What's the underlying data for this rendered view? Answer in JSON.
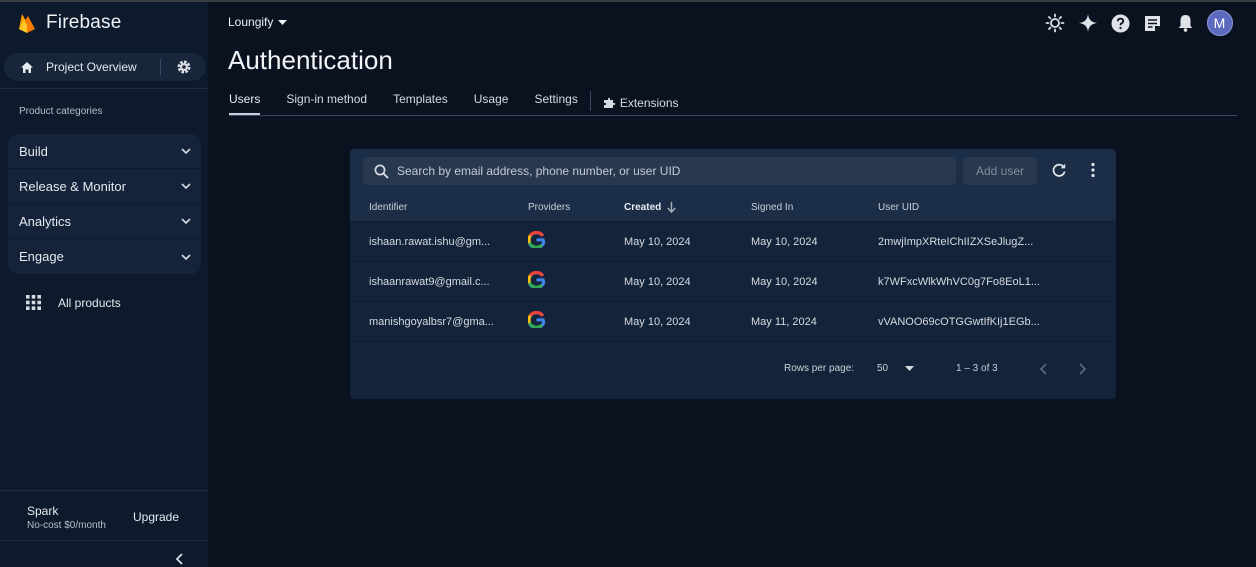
{
  "brand": {
    "name": "Firebase"
  },
  "sidebar": {
    "overview_label": "Project Overview",
    "categories_title": "Product categories",
    "categories": [
      {
        "label": "Build"
      },
      {
        "label": "Release & Monitor"
      },
      {
        "label": "Analytics"
      },
      {
        "label": "Engage"
      }
    ],
    "all_products": "All products",
    "plan_name": "Spark",
    "plan_sub": "No-cost $0/month",
    "upgrade": "Upgrade"
  },
  "header": {
    "project": "Loungify",
    "avatar_letter": "M",
    "icons": [
      "theme-icon",
      "gemini-sparkle-icon",
      "help-icon",
      "release-notes-icon",
      "notifications-icon"
    ]
  },
  "page": {
    "title": "Authentication",
    "tabs": [
      {
        "label": "Users",
        "active": true
      },
      {
        "label": "Sign-in method"
      },
      {
        "label": "Templates"
      },
      {
        "label": "Usage"
      },
      {
        "label": "Settings"
      }
    ],
    "extensions_tab": "Extensions"
  },
  "users_table": {
    "search_placeholder": "Search by email address, phone number, or user UID",
    "add_user": "Add user",
    "headers": [
      "Identifier",
      "Providers",
      "Created",
      "Signed In",
      "User UID"
    ],
    "rows": [
      {
        "identifier": "ishaan.rawat.ishu@gm...",
        "provider": "google-icon",
        "created": "May 10, 2024",
        "signed_in": "May 10, 2024",
        "uid": "2mwjImpXRteIChIIZXSeJlugZ..."
      },
      {
        "identifier": "ishaanrawat9@gmail.c...",
        "provider": "google-icon",
        "created": "May 10, 2024",
        "signed_in": "May 10, 2024",
        "uid": "k7WFxcWlkWhVC0g7Fo8EoL1..."
      },
      {
        "identifier": "manishgoyalbsr7@gma...",
        "provider": "google-icon",
        "created": "May 10, 2024",
        "signed_in": "May 11, 2024",
        "uid": "vVANOO69cOTGGwtIfKIj1EGb..."
      }
    ],
    "rows_per_page_label": "Rows per page:",
    "rows_per_page_value": "50",
    "range": "1 – 3 of 3"
  },
  "colors": {
    "background": "#0a1220",
    "sidebar": "#0d1a2c",
    "card": "#132339",
    "accent_avatar": "#5c6bc0"
  }
}
